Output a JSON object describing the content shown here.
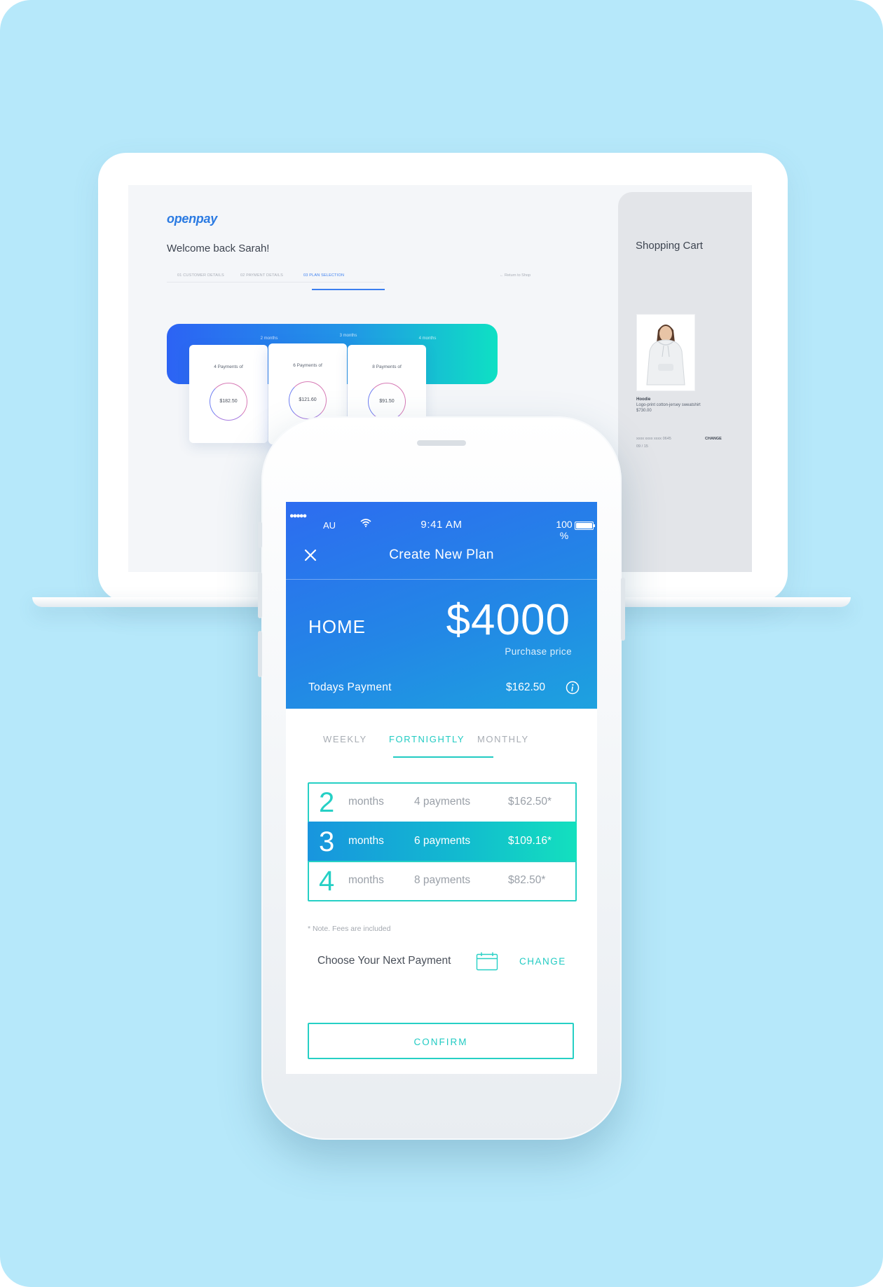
{
  "desktop": {
    "logo": "openpay",
    "welcome": "Welcome back Sarah!",
    "steps": [
      "01 CUSTOMER DETAILS",
      "02 PAYMENT DETAILS",
      "03 PLAN SELECTION"
    ],
    "return_link": "Return to Shop",
    "plan_cards": [
      {
        "duration": "2 months",
        "title": "4 Payments of",
        "amount": "$182.50"
      },
      {
        "duration": "3 months",
        "title": "6 Payments of",
        "amount": "$121.60"
      },
      {
        "duration": "4 months",
        "title": "8 Payments of",
        "amount": "$91.50"
      }
    ],
    "cart": {
      "title": "Shopping Cart",
      "product_name": "Hoodie",
      "product_desc": "Logo-print cotton-jersey sweatshirt",
      "product_price": "$730.00",
      "card_number": "xxxx xxxx xxxx 0645",
      "card_expiry": "09 / 15",
      "change_label": "CHANGE"
    }
  },
  "phone": {
    "status": {
      "carrier": "AU",
      "time": "9:41 AM",
      "battery": "100 %"
    },
    "header": {
      "title": "Create New Plan"
    },
    "plan": {
      "name": "HOME",
      "price": "$4000",
      "price_caption": "Purchase price",
      "todays_label": "Todays Payment",
      "todays_amount": "$162.50"
    },
    "tabs": [
      {
        "label": "WEEKLY"
      },
      {
        "label": "FORTNIGHTLY"
      },
      {
        "label": "MONTHLY"
      }
    ],
    "active_tab": "FORTNIGHTLY",
    "options": [
      {
        "num": "2",
        "unit": "months",
        "payments": "4 payments",
        "amount": "$162.50*"
      },
      {
        "num": "3",
        "unit": "months",
        "payments": "6 payments",
        "amount": "$109.16*"
      },
      {
        "num": "4",
        "unit": "months",
        "payments": "8 payments",
        "amount": "$82.50*"
      }
    ],
    "selected_option": "3",
    "note": "* Note. Fees are included",
    "next_payment_label": "Choose Your Next Payment",
    "change_label": "CHANGE",
    "confirm_label": "CONFIRM"
  },
  "colors": {
    "background": "#b6e8fa",
    "header_blue": "#2d6cf0",
    "accent_teal": "#22cbc3"
  }
}
